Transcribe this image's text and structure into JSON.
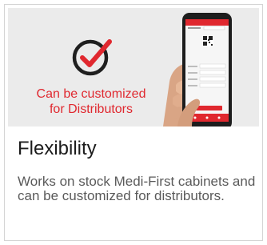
{
  "hero": {
    "caption_line1": "Can be customized",
    "caption_line2": "for Distributors",
    "accent_color": "#e0282f",
    "icon": "check-circle-icon",
    "phone_icon": "qr-code-icon"
  },
  "card": {
    "title": "Flexibility",
    "description": "Works on stock Medi-First cabinets and can be customized for distributors."
  }
}
